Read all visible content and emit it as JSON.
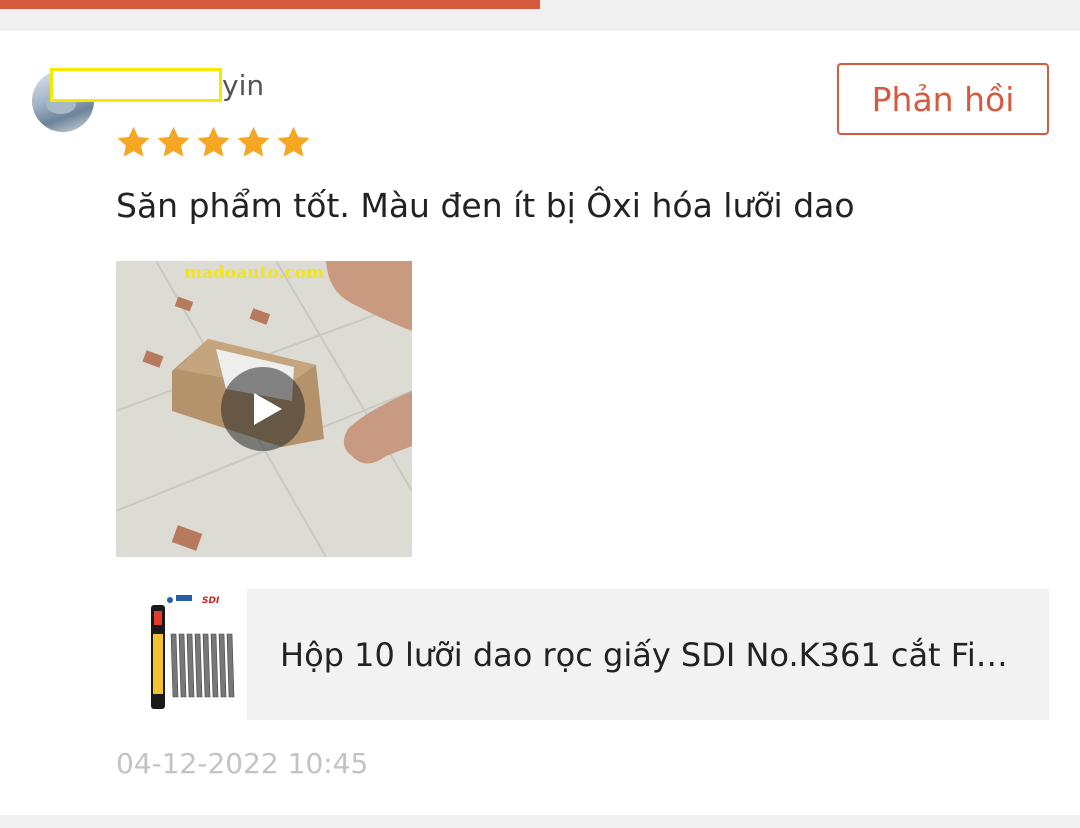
{
  "review": {
    "username_suffix": "yin",
    "reply_label": "Phản hồi",
    "rating": 5,
    "text": "Săn phẩm tốt. Màu đen ít bị Ôxi hóa lưỡi dao",
    "media": {
      "watermark": "madoauto.com",
      "type": "video"
    },
    "product": {
      "title": "Hộp 10 lưỡi dao rọc giấy SDI No.K361 cắt Fi…",
      "thumb_brand": "SDI"
    },
    "timestamp": "04-12-2022 10:45"
  },
  "colors": {
    "accent": "#d65a3e",
    "star": "#f5a623",
    "mask_border": "#f5e900",
    "timestamp": "#c3c3c3"
  }
}
